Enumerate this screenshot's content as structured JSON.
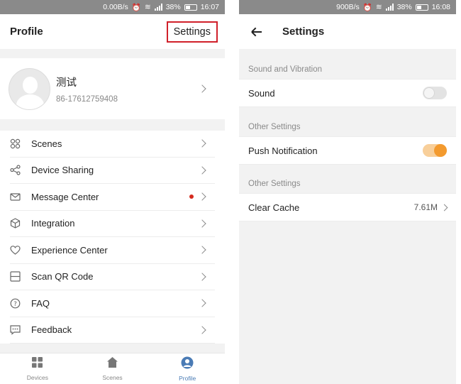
{
  "left": {
    "status": {
      "speed": "0.00B/s",
      "battery": "38%",
      "time": "16:07"
    },
    "header": {
      "title": "Profile",
      "settings_label": "Settings"
    },
    "profile": {
      "name": "测试",
      "phone": "86-17612759408"
    },
    "menu": [
      {
        "label": "Scenes",
        "icon": "scenes-icon"
      },
      {
        "label": "Device Sharing",
        "icon": "share-icon"
      },
      {
        "label": "Message Center",
        "icon": "mail-icon",
        "badge": true
      },
      {
        "label": "Integration",
        "icon": "cube-icon"
      },
      {
        "label": "Experience Center",
        "icon": "heart-icon"
      },
      {
        "label": "Scan QR Code",
        "icon": "scan-icon"
      },
      {
        "label": "FAQ",
        "icon": "question-icon"
      },
      {
        "label": "Feedback",
        "icon": "chat-icon"
      }
    ],
    "tabs": [
      {
        "label": "Devices",
        "icon": "grid-icon"
      },
      {
        "label": "Scenes",
        "icon": "home-icon"
      },
      {
        "label": "Profile",
        "icon": "profile-icon",
        "active": true
      }
    ],
    "colors": {
      "highlight_box": "#d0202a",
      "active_tab": "#4a7bb5",
      "badge": "#d52b1e"
    }
  },
  "right": {
    "status": {
      "speed": "900B/s",
      "battery": "38%",
      "time": "16:08"
    },
    "header": {
      "title": "Settings"
    },
    "sections": [
      {
        "header": "Sound and Vibration",
        "row": {
          "label": "Sound",
          "toggle": false
        }
      },
      {
        "header": "Other Settings",
        "row": {
          "label": "Push Notification",
          "toggle": true
        }
      },
      {
        "header": "Other Settings",
        "row": {
          "label": "Clear Cache",
          "value": "7.61M"
        }
      }
    ],
    "colors": {
      "toggle_on": "#f39a2e"
    }
  }
}
